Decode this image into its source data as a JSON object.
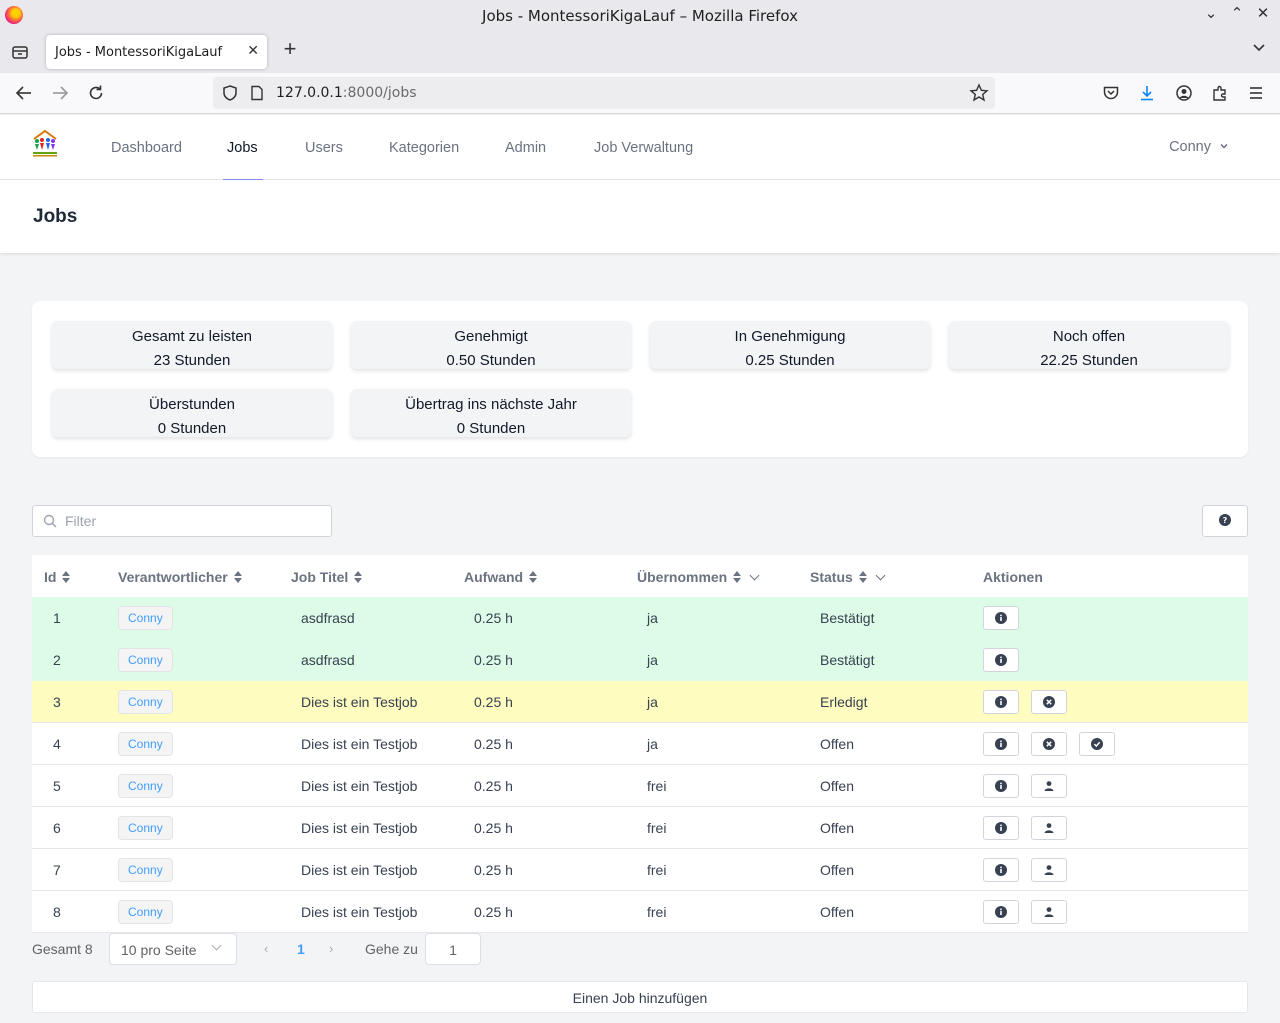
{
  "browser": {
    "window_title": "Jobs - MontessoriKigaLauf – Mozilla Firefox",
    "tab_title": "Jobs - MontessoriKigaLauf",
    "url_host": "127.0.0.1",
    "url_path": ":8000/jobs"
  },
  "nav": {
    "items": [
      "Dashboard",
      "Jobs",
      "Users",
      "Kategorien",
      "Admin",
      "Job Verwaltung"
    ],
    "active": "Jobs",
    "user": "Conny"
  },
  "page": {
    "title": "Jobs"
  },
  "stats": [
    {
      "label": "Gesamt zu leisten",
      "value": "23 Stunden"
    },
    {
      "label": "Genehmigt",
      "value": "0.50 Stunden"
    },
    {
      "label": "In Genehmigung",
      "value": "0.25 Stunden"
    },
    {
      "label": "Noch offen",
      "value": "22.25 Stunden"
    },
    {
      "label": "Überstunden",
      "value": "0 Stunden"
    },
    {
      "label": "Übertrag ins nächste Jahr",
      "value": "0 Stunden"
    }
  ],
  "filter": {
    "placeholder": "Filter"
  },
  "table": {
    "columns": [
      "Id",
      "Verantwortlicher",
      "Job Titel",
      "Aufwand",
      "Übernommen",
      "Status",
      "Aktionen"
    ],
    "rows": [
      {
        "id": "1",
        "owner": "Conny",
        "title": "asdfrasd",
        "effort": "0.25 h",
        "taken": "ja",
        "status": "Bestätigt",
        "highlight": "green",
        "actions": [
          "info"
        ]
      },
      {
        "id": "2",
        "owner": "Conny",
        "title": "asdfrasd",
        "effort": "0.25 h",
        "taken": "ja",
        "status": "Bestätigt",
        "highlight": "green",
        "actions": [
          "info"
        ]
      },
      {
        "id": "3",
        "owner": "Conny",
        "title": "Dies ist ein Testjob",
        "effort": "0.25 h",
        "taken": "ja",
        "status": "Erledigt",
        "highlight": "yellow",
        "actions": [
          "info",
          "cancel"
        ]
      },
      {
        "id": "4",
        "owner": "Conny",
        "title": "Dies ist ein Testjob",
        "effort": "0.25 h",
        "taken": "ja",
        "status": "Offen",
        "highlight": "none",
        "actions": [
          "info",
          "cancel",
          "confirm"
        ]
      },
      {
        "id": "5",
        "owner": "Conny",
        "title": "Dies ist ein Testjob",
        "effort": "0.25 h",
        "taken": "frei",
        "status": "Offen",
        "highlight": "none",
        "actions": [
          "info",
          "take"
        ]
      },
      {
        "id": "6",
        "owner": "Conny",
        "title": "Dies ist ein Testjob",
        "effort": "0.25 h",
        "taken": "frei",
        "status": "Offen",
        "highlight": "none",
        "actions": [
          "info",
          "take"
        ]
      },
      {
        "id": "7",
        "owner": "Conny",
        "title": "Dies ist ein Testjob",
        "effort": "0.25 h",
        "taken": "frei",
        "status": "Offen",
        "highlight": "none",
        "actions": [
          "info",
          "take"
        ]
      },
      {
        "id": "8",
        "owner": "Conny",
        "title": "Dies ist ein Testjob",
        "effort": "0.25 h",
        "taken": "frei",
        "status": "Offen",
        "highlight": "none",
        "actions": [
          "info",
          "take"
        ]
      }
    ]
  },
  "pagination": {
    "total": "Gesamt 8",
    "page_size": "10 pro Seite",
    "current_page": "1",
    "goto_label": "Gehe zu",
    "goto_value": "1"
  },
  "add_button": "Einen Job hinzufügen",
  "colors": {
    "accent": "#818cf8",
    "row_green": "#dcfce7",
    "row_yellow": "#fefcbf",
    "tag_text": "#409eff"
  }
}
